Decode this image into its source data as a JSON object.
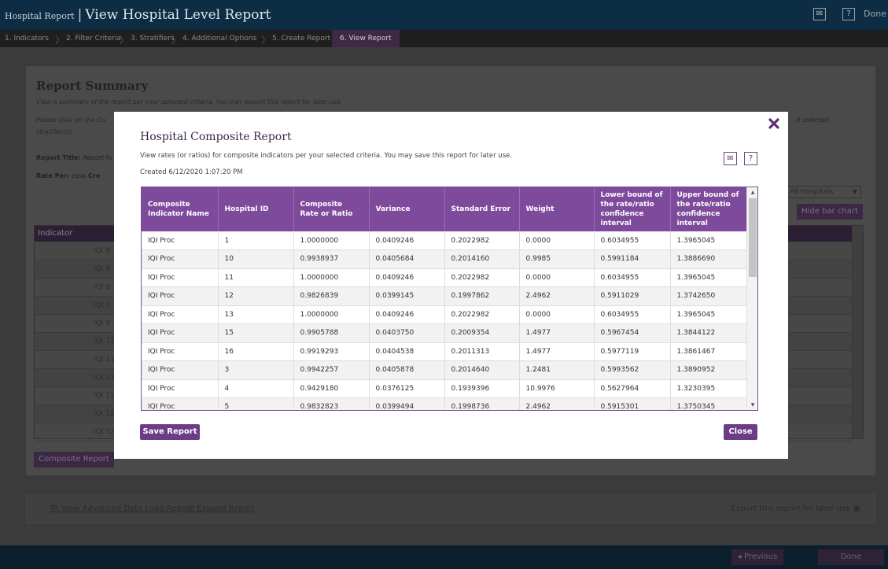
{
  "app": {
    "title_small": "Hospital Report",
    "title_sep": "|",
    "title_main": "View Hospital Level Report",
    "done_link": "Done"
  },
  "steps": [
    {
      "label": "1. Indicators"
    },
    {
      "label": "2. Filter Criteria"
    },
    {
      "label": "3. Stratifiers"
    },
    {
      "label": "4. Additional Options"
    },
    {
      "label": "5. Create Report"
    },
    {
      "label": "6. View Report",
      "active": true
    }
  ],
  "background": {
    "heading": "Report Summary",
    "subtitle": "View a summary of the report per your selected criteria. You may export this report for later use.",
    "instruction_start": "Please click on the Ou",
    "instruction_end": "stratifier(s).",
    "instruction_right": "d selected",
    "report_title_label": "Report Title:",
    "report_title_value": "Report fo",
    "rate_per_label": "Rate Per:",
    "rate_per_value": "case",
    "rate_per_extra": "Cre",
    "hospitals_select": "All Hospitals",
    "hide_chart_button": "Hide bar chart",
    "indicator_header": "Indicator",
    "indicator_rows": [
      "IQI 8",
      "IQI 8",
      "IQI 9",
      "IQI 9",
      "IQI 9",
      "IQI 11",
      "IQI 11",
      "IQI 11",
      "IQI 11",
      "IQI 12",
      "IQI 12"
    ],
    "composite_button": "Composite Report",
    "advanced_link": "View Advanced Data Load Report",
    "expand_link": "Expand Report",
    "export_text": "Export this report for later use",
    "previous_button": "Previous",
    "done_button": "Done"
  },
  "modal": {
    "title": "Hospital Composite Report",
    "description": "View rates (or ratios) for composite indicators per your selected criteria. You may save this report for later use.",
    "created": "Created 6/12/2020 1:07:20 PM",
    "save_button": "Save Report",
    "close_button": "Close",
    "columns": [
      "Composite Indicator Name",
      "Hospital ID",
      "Composite Rate or Ratio",
      "Variance",
      "Standard Error",
      "Weight",
      "Lower bound of the rate/ratio confidence interval",
      "Upper bound of the rate/ratio confidence interval"
    ],
    "rows": [
      [
        "IQI Proc",
        "1",
        "1.0000000",
        "0.0409246",
        "0.2022982",
        "0.0000",
        "0.6034955",
        "1.3965045"
      ],
      [
        "IQI Proc",
        "10",
        "0.9938937",
        "0.0405684",
        "0.2014160",
        "0.9985",
        "0.5991184",
        "1.3886690"
      ],
      [
        "IQI Proc",
        "11",
        "1.0000000",
        "0.0409246",
        "0.2022982",
        "0.0000",
        "0.6034955",
        "1.3965045"
      ],
      [
        "IQI Proc",
        "12",
        "0.9826839",
        "0.0399145",
        "0.1997862",
        "2.4962",
        "0.5911029",
        "1.3742650"
      ],
      [
        "IQI Proc",
        "13",
        "1.0000000",
        "0.0409246",
        "0.2022982",
        "0.0000",
        "0.6034955",
        "1.3965045"
      ],
      [
        "IQI Proc",
        "15",
        "0.9905788",
        "0.0403750",
        "0.2009354",
        "1.4977",
        "0.5967454",
        "1.3844122"
      ],
      [
        "IQI Proc",
        "16",
        "0.9919293",
        "0.0404538",
        "0.2011313",
        "1.4977",
        "0.5977119",
        "1.3861467"
      ],
      [
        "IQI Proc",
        "3",
        "0.9942257",
        "0.0405878",
        "0.2014640",
        "1.2481",
        "0.5993562",
        "1.3890952"
      ],
      [
        "IQI Proc",
        "4",
        "0.9429180",
        "0.0376125",
        "0.1939396",
        "10.9976",
        "0.5627964",
        "1.3230395"
      ],
      [
        "IQI Proc",
        "5",
        "0.9832823",
        "0.0399494",
        "0.1998736",
        "2.4962",
        "0.5915301",
        "1.3750345"
      ]
    ]
  },
  "colors": {
    "accent": "#7e4a9c",
    "topbar": "#0c2d44",
    "overlay": "#3b3b3b"
  }
}
